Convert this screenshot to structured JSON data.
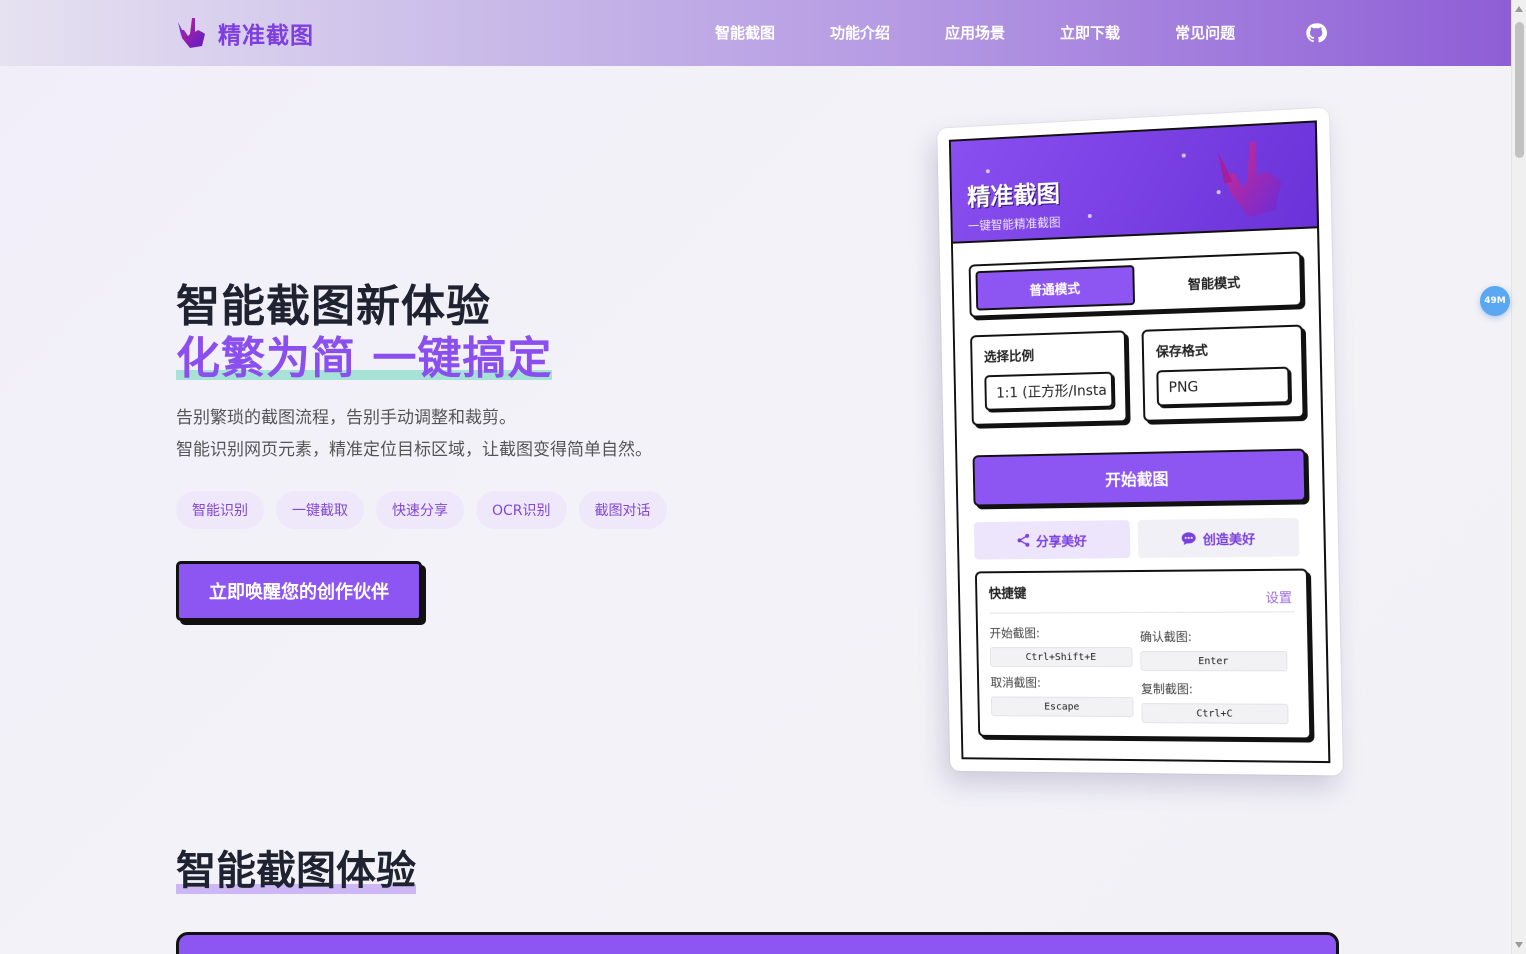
{
  "nav": {
    "brand": "精准截图",
    "links": [
      "智能截图",
      "功能介绍",
      "应用场景",
      "立即下载",
      "常见问题"
    ],
    "github_icon": "github-icon"
  },
  "memory_badge": "49M",
  "hero": {
    "title_line1": "智能截图新体验",
    "title_line2": "化繁为简 一键搞定",
    "desc_line1": "告别繁琐的截图流程，告别手动调整和裁剪。",
    "desc_line2": "智能识别网页元素，精准定位目标区域，让截图变得简单自然。",
    "tags": [
      "智能识别",
      "一键截取",
      "快速分享",
      "OCR识别",
      "截图对话"
    ],
    "cta": "立即唤醒您的创作伙伴"
  },
  "mockup": {
    "title": "精准截图",
    "subtitle": "一键智能精准截图",
    "modes": {
      "normal": "普通模式",
      "smart": "智能模式"
    },
    "ratio_label": "选择比例",
    "ratio_value": "1:1 (正方形/Insta",
    "format_label": "保存格式",
    "format_value": "PNG",
    "start_button": "开始截图",
    "share_button": "分享美好",
    "create_button": "创造美好",
    "shortcuts": {
      "title": "快捷键",
      "settings": "设置",
      "items": [
        {
          "label": "开始截图:",
          "key": "Ctrl+Shift+E"
        },
        {
          "label": "确认截图:",
          "key": "Enter"
        },
        {
          "label": "取消截图:",
          "key": "Escape"
        },
        {
          "label": "复制截图:",
          "key": "Ctrl+C"
        }
      ]
    }
  },
  "section2": {
    "title": "智能截图体验"
  },
  "colors": {
    "accent": "#8d56f2",
    "brand": "#7e3fe0",
    "ink": "#111111"
  }
}
